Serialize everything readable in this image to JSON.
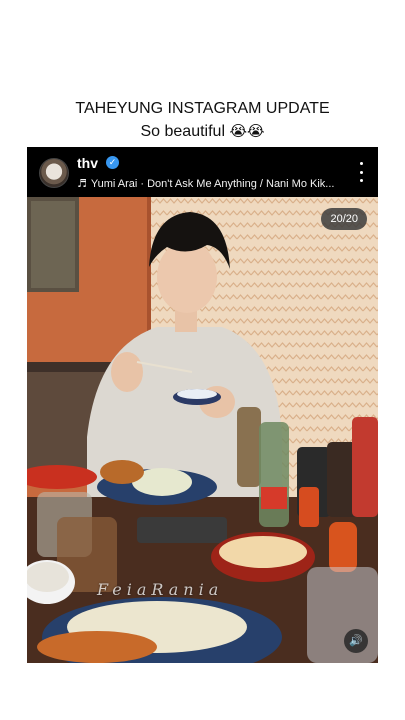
{
  "caption": {
    "line1": "TAHEYUNG INSTAGRAM UPDATE",
    "line2": "So beautiful",
    "emoji": "😭😭"
  },
  "post": {
    "username": "thv",
    "verified_mark": "✓",
    "music_icon": "♬",
    "music_text": "Yumi Arai · Don't Ask Me Anything / Nani Mo Kik...",
    "counter": "20/20",
    "watermark": "FeiaRania",
    "mute_icon": "🔊"
  }
}
